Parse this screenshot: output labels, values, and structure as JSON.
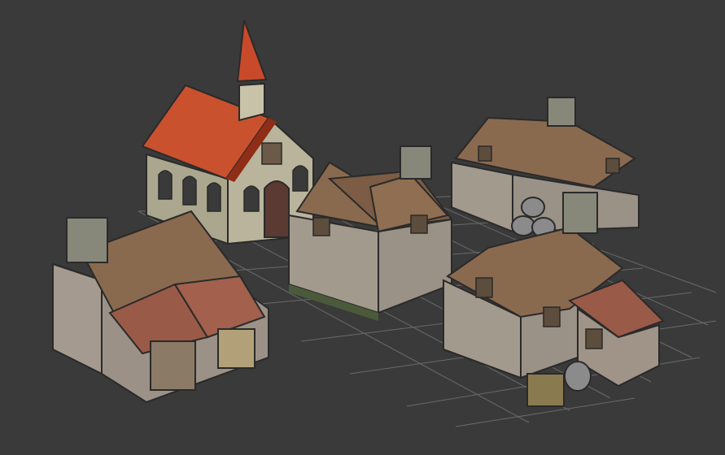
{
  "viewport": {
    "background": "#3a3a3a",
    "grid_color": "#6b6b6b"
  },
  "scene": {
    "objects": [
      {
        "name": "chapel",
        "roof_color": "#c94a2a",
        "wall_color": "#b7b39a"
      },
      {
        "name": "cottage-with-shed",
        "roof_color": "#8a6a4f",
        "wall_color": "#a89f94"
      },
      {
        "name": "cross-gable-house",
        "roof_color": "#8a6a4f",
        "wall_color": "#a89f94"
      },
      {
        "name": "l-shaped-house",
        "roof_color": "#8a6a4f",
        "wall_color": "#a89f94"
      },
      {
        "name": "house-with-annex",
        "roof_color": "#8a6a4f",
        "wall_color": "#a89f94"
      },
      {
        "name": "barrel-stack",
        "color": "#8a8a8a"
      },
      {
        "name": "single-barrel",
        "color": "#8a8a8a"
      }
    ]
  }
}
